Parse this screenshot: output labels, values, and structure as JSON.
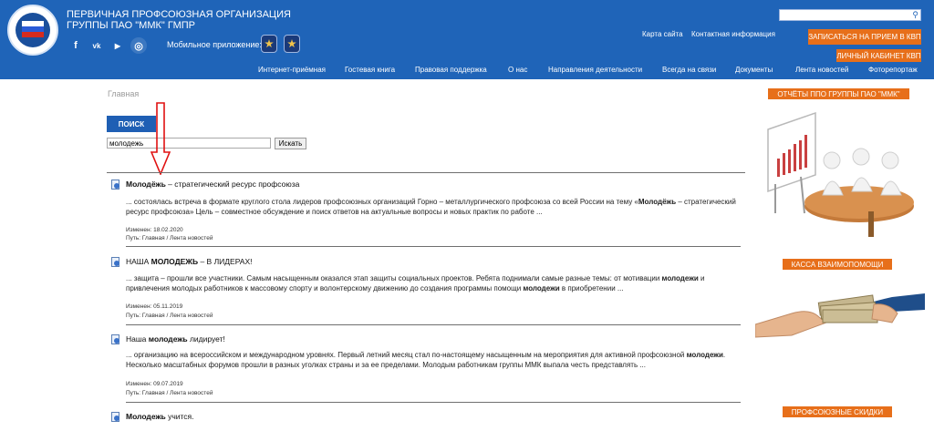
{
  "header": {
    "org_line1": "ПЕРВИЧНАЯ ПРОФСОЮЗНАЯ ОРГАНИЗАЦИЯ",
    "org_line2": "ГРУППЫ ПАО \"ММК\" ГМПР",
    "socials": [
      {
        "icon": "facebook-icon",
        "glyph": "f"
      },
      {
        "icon": "vk-icon",
        "glyph": "vk"
      },
      {
        "icon": "youtube-icon",
        "glyph": "▶"
      },
      {
        "icon": "instagram-icon",
        "glyph": "◎"
      }
    ],
    "mobile_label": "Мобильное приложение:",
    "top_links": [
      "Карта сайта",
      "Контактная информация"
    ],
    "buttons": {
      "appointment": "ЗАПИСАТЬСЯ НА ПРИЕМ В КВП",
      "cabinet": "ЛИЧНЫЙ КАБИНЕТ КВП"
    },
    "brand_color": "#1f64b8",
    "accent_color": "#e76f1a"
  },
  "nav": [
    "Интернет-приёмная",
    "Гостевая книга",
    "Правовая поддержка",
    "О нас",
    "Направления деятельности",
    "Всегда на связи",
    "Документы",
    "Лента новостей",
    "Фоторепортаж"
  ],
  "breadcrumb": "Главная",
  "search": {
    "heading_button": "ПОИСК",
    "query": "молодежь",
    "submit_label": "Искать"
  },
  "results": [
    {
      "title_bold": "Молодёжь",
      "title_rest": " – стратегический ресурс профсоюза",
      "snippet_parts": [
        {
          "text": "... состоялась встреча в формате круглого стола лидеров профсоюзных организаций Горно – металлургического профсоюза со всей России на тему «",
          "b": false
        },
        {
          "text": "Молодёжь",
          "b": true
        },
        {
          "text": " – стратегический ресурс профсоюза» Цель – совместное обсуждение и поиск ответов на актуальные вопросы и новых практик по работе ...",
          "b": false
        }
      ],
      "changed": "Изменен: 18.02.2020",
      "path": "Путь: Главная / Лента новостей"
    },
    {
      "title_bold": "НАША МОЛОДЕЖЬ",
      "title_prefix": "",
      "title_rest": " – В ЛИДЕРАХ!",
      "snippet_parts": [
        {
          "text": "... защита – прошли все участники. Самым насыщенным оказался этап защиты социальных проектов. Ребята поднимали самые разные темы: от мотивации ",
          "b": false
        },
        {
          "text": "молодежи",
          "b": true
        },
        {
          "text": " и привлечения молодых работников к массовому спорту и волонтерскому движению до создания программы помощи ",
          "b": false
        },
        {
          "text": "молодежи",
          "b": true
        },
        {
          "text": " в приобретении ...",
          "b": false
        }
      ],
      "changed": "Изменен: 05.11.2019",
      "path": "Путь: Главная / Лента новостей"
    },
    {
      "title_prefix": "Наша ",
      "title_bold": "молодежь",
      "title_rest": " лидирует!",
      "snippet_parts": [
        {
          "text": "... организацию на всероссийском и международном уровнях. Первый летний месяц стал по-настоящему насыщенным на мероприятия для активной профсоюзной ",
          "b": false
        },
        {
          "text": "молодежи",
          "b": true
        },
        {
          "text": ". Несколько масштабных форумов прошли в разных уголках страны и за ее пределами. Молодым работникам группы ММК выпала честь представлять ...",
          "b": false
        }
      ],
      "changed": "Изменен: 09.07.2019",
      "path": "Путь: Главная / Лента новостей"
    },
    {
      "title_prefix": "",
      "title_bold": "Молодежь",
      "title_rest": " учится.",
      "snippet_parts": [],
      "changed": "",
      "path": ""
    }
  ],
  "sidebar": {
    "reports": "ОТЧЁТЫ ППО ГРУППЫ ПАО \"ММК\"",
    "kassa": "КАССА ВЗАИМОПОМОЩИ",
    "discounts": "ПРОФСОЮЗНЫЕ СКИДКИ"
  }
}
